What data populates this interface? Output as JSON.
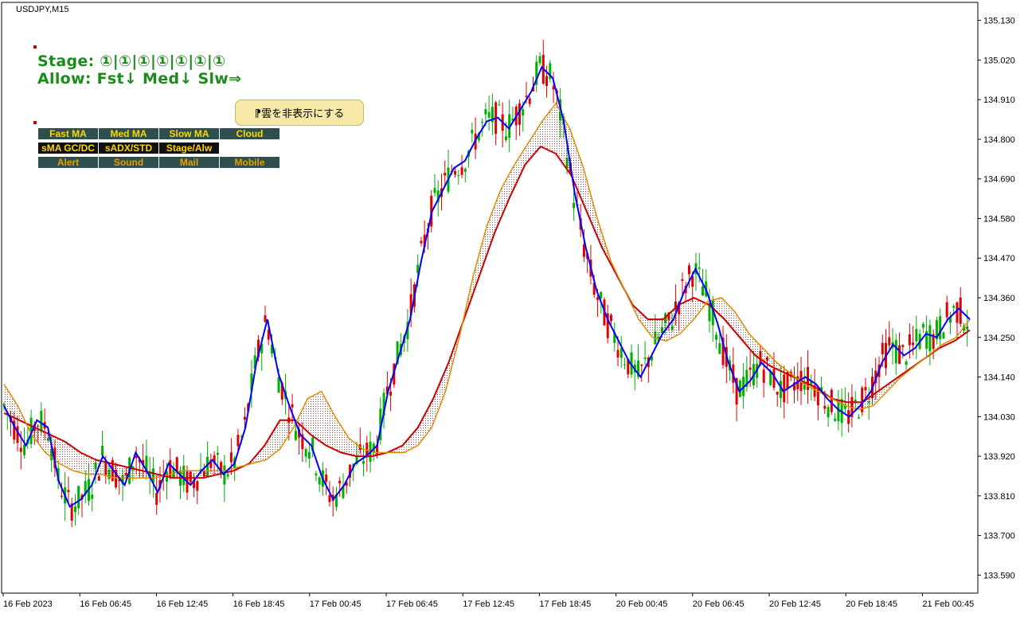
{
  "symbol": "USDJPY,M15",
  "stage_line": "Stage: ①|①|①|①|①|①|①",
  "allow_line": "Allow: Fst↓ Med↓ Slw⇒",
  "cloud_button": "⁋雲を非表示にする",
  "panel": {
    "row1": [
      "Fast MA",
      "Med MA",
      "Slow MA",
      "Cloud"
    ],
    "row2": [
      "sMA GC/DC",
      "sADX/STD",
      "Stage/Alw"
    ],
    "row3": [
      "Alert",
      "Sound",
      "Mail",
      "Mobile"
    ]
  },
  "colors": {
    "bull": "#00b000",
    "bear": "#e00000",
    "fast_ma": "#0000ff",
    "med_ma": "#e08c00",
    "slow_ma": "#cc0000",
    "cloud": "#8b1a1a",
    "sell_arrow": "#0000ff",
    "buy_arrow": "#ff0000"
  },
  "chart_data": {
    "type": "candlestick",
    "symbol": "USDJPY",
    "timeframe": "M15",
    "ylim": [
      133.54,
      135.18
    ],
    "y_ticks": [
      "135.130",
      "135.020",
      "134.910",
      "134.800",
      "134.690",
      "134.580",
      "134.470",
      "134.360",
      "134.250",
      "134.140",
      "134.030",
      "133.920",
      "133.810",
      "133.700",
      "133.590"
    ],
    "x_ticks": [
      "16 Feb 2023",
      "16 Feb 06:45",
      "16 Feb 12:45",
      "16 Feb 18:45",
      "17 Feb 00:45",
      "17 Feb 06:45",
      "17 Feb 12:45",
      "17 Feb 18:45",
      "20 Feb 00:45",
      "20 Feb 06:45",
      "20 Feb 12:45",
      "20 Feb 18:45",
      "21 Feb 00:45"
    ],
    "fast_ma": [
      134.06,
      134.0,
      133.95,
      134.02,
      134.0,
      133.85,
      133.78,
      133.8,
      133.84,
      133.92,
      133.88,
      133.84,
      133.93,
      133.88,
      133.82,
      133.9,
      133.87,
      133.84,
      133.88,
      133.91,
      133.87,
      133.9,
      134.0,
      134.18,
      134.3,
      134.15,
      134.06,
      133.98,
      133.95,
      133.86,
      133.8,
      133.84,
      133.9,
      133.92,
      133.95,
      134.1,
      134.2,
      134.3,
      134.46,
      134.6,
      134.66,
      134.72,
      134.74,
      134.8,
      134.85,
      134.86,
      134.83,
      134.88,
      134.93,
      135.0,
      134.97,
      134.85,
      134.65,
      134.5,
      134.38,
      134.3,
      134.24,
      134.18,
      134.14,
      134.2,
      134.26,
      134.3,
      134.38,
      134.44,
      134.38,
      134.29,
      134.18,
      134.1,
      134.13,
      134.18,
      134.15,
      134.1,
      134.12,
      134.14,
      134.12,
      134.08,
      134.05,
      134.03,
      134.06,
      134.1,
      134.18,
      134.23,
      134.2,
      134.22,
      134.26,
      134.25,
      134.3,
      134.33,
      134.3
    ],
    "med_ma": [
      134.12,
      134.06,
      133.98,
      133.93,
      133.9,
      133.88,
      133.87,
      133.87,
      133.86,
      133.86,
      133.86,
      133.86,
      133.87,
      133.88,
      133.88,
      133.88,
      133.88,
      133.89,
      133.9,
      133.91,
      133.94,
      134.0,
      134.08,
      134.1,
      134.03,
      133.97,
      133.94,
      133.93,
      133.93,
      133.93,
      133.95,
      134.0,
      134.1,
      134.25,
      134.42,
      134.56,
      134.66,
      134.73,
      134.79,
      134.85,
      134.9,
      134.83,
      134.72,
      134.58,
      134.46,
      134.38,
      134.3,
      134.25,
      134.24,
      134.26,
      134.3,
      134.35,
      134.36,
      134.32,
      134.26,
      134.22,
      134.18,
      134.15,
      134.12,
      134.1,
      134.08,
      134.06,
      134.05,
      134.06,
      134.1,
      134.14,
      134.17,
      134.2,
      134.23,
      134.25,
      134.3
    ],
    "slow_ma": [
      134.04,
      134.02,
      134.0,
      133.98,
      133.96,
      133.93,
      133.91,
      133.9,
      133.89,
      133.88,
      133.87,
      133.86,
      133.86,
      133.86,
      133.87,
      133.88,
      133.9,
      133.95,
      134.02,
      134.02,
      133.98,
      133.95,
      133.93,
      133.92,
      133.92,
      133.93,
      133.95,
      134.0,
      134.08,
      134.18,
      134.3,
      134.42,
      134.54,
      134.64,
      134.73,
      134.78,
      134.76,
      134.7,
      134.6,
      134.5,
      134.42,
      134.34,
      134.3,
      134.3,
      134.34,
      134.36,
      134.34,
      134.3,
      134.25,
      134.2,
      134.17,
      134.15,
      134.13,
      134.11,
      134.08,
      134.07,
      134.07,
      134.1,
      134.13,
      134.16,
      134.19,
      134.22,
      134.24,
      134.27
    ]
  }
}
